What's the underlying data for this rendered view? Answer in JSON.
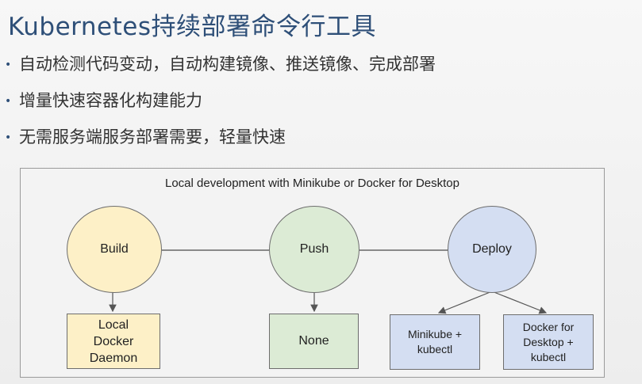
{
  "title": "Kubernetes持续部署命令行工具",
  "bullets": [
    "自动检测代码变动，自动构建镜像、推送镜像、完成部署",
    "增量快速容器化构建能力",
    "无需服务端服务部署需要，轻量快速"
  ],
  "diagram": {
    "title": "Local development with Minikube or Docker for Desktop",
    "stages": [
      {
        "label": "Build",
        "color": "#fdf0c7"
      },
      {
        "label": "Push",
        "color": "#dcebd5"
      },
      {
        "label": "Deploy",
        "color": "#d4def2"
      }
    ],
    "targets": [
      {
        "label": "Local\nDocker\nDaemon",
        "color": "#fdf0c7"
      },
      {
        "label": "None",
        "color": "#dcebd5"
      },
      {
        "label": "Minikube +\nkubectl",
        "color": "#d4def2"
      },
      {
        "label": "Docker for\nDesktop +\nkubectl",
        "color": "#d4def2"
      }
    ]
  }
}
